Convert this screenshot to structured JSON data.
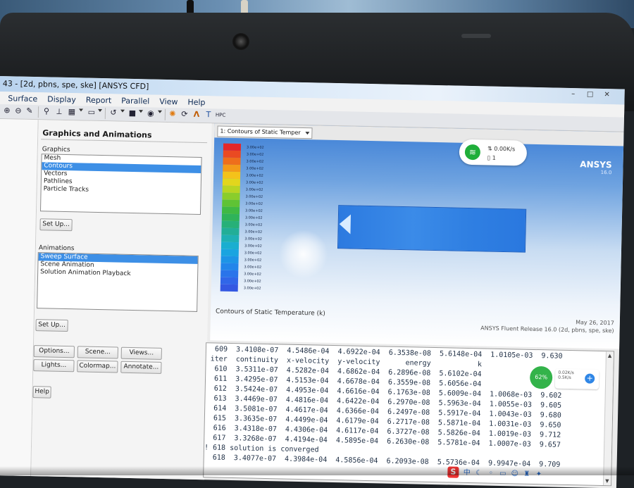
{
  "window": {
    "title": "43 - [2d, pbns, spe, ske] [ANSYS CFD]"
  },
  "menu": [
    "Surface",
    "Display",
    "Report",
    "Parallel",
    "View",
    "Help"
  ],
  "panel": {
    "title": "Graphics and Animations",
    "graphics_label": "Graphics",
    "graphics_items": [
      "Mesh",
      "Contours",
      "Vectors",
      "Pathlines",
      "Particle Tracks"
    ],
    "graphics_selected": "Contours",
    "setup_label": "Set Up...",
    "animations_label": "Animations",
    "animation_items": [
      "Sweep Surface",
      "Scene Animation",
      "Solution Animation Playback"
    ],
    "animation_selected": "Sweep Surface",
    "setup2_label": "Set Up...",
    "buttons": [
      "Options...",
      "Scene...",
      "Views...",
      "Lights...",
      "Colormap...",
      "Annotate..."
    ],
    "help_label": "Help"
  },
  "graphics_window": {
    "tab_label": "1: Contours of Static Temper",
    "colorbar_labels": [
      "3.00e+02",
      "3.00e+02",
      "3.00e+02",
      "3.00e+02",
      "3.00e+02",
      "3.00e+02",
      "3.00e+02",
      "3.00e+02",
      "3.00e+02",
      "3.00e+02",
      "3.00e+02",
      "3.00e+02",
      "3.00e+02",
      "3.00e+02",
      "3.00e+02",
      "3.00e+02",
      "3.00e+02",
      "3.00e+02",
      "3.00e+02",
      "3.00e+02",
      "3.00e+02"
    ],
    "colorbar_colors": [
      "#e3272a",
      "#ea4a22",
      "#ee6e1c",
      "#f39a19",
      "#f4c21a",
      "#e2d61d",
      "#b8d523",
      "#8acd2c",
      "#5fc335",
      "#3fb944",
      "#2fb35a",
      "#27b078",
      "#22ae97",
      "#1fb0b4",
      "#1aaed0",
      "#1aa4e0",
      "#1d94e6",
      "#2285ea",
      "#2a74ea",
      "#3166e8",
      "#3458e2"
    ],
    "logo": "ANSYS",
    "logo_version": "16.0",
    "caption": "Contours of Static Temperature (k)",
    "date": "May 26, 2017",
    "release": "ANSYS Fluent Release 16.0 (2d, pbns, spe, ske)"
  },
  "network_widget": {
    "speed": "0.00K/s",
    "count": "1"
  },
  "console": {
    "lines": [
      "  609  3.4108e-07  4.5486e-04  4.6922e-04  6.3538e-08  5.6148e-04  1.0105e-03  9.630",
      " iter  continuity  x-velocity  y-velocity      energy           k",
      "  610  3.5311e-07  4.5282e-04  4.6862e-04  6.2896e-08  5.6102e-04",
      "  611  3.4295e-07  4.5153e-04  4.6678e-04  6.3559e-08  5.6056e-04",
      "  612  3.5424e-07  4.4953e-04  4.6616e-04  6.1763e-08  5.6009e-04  1.0068e-03  9.602",
      "  613  3.4469e-07  4.4816e-04  4.6422e-04  6.2970e-08  5.5963e-04  1.0055e-03  9.605",
      "  614  3.5081e-07  4.4617e-04  4.6366e-04  6.2497e-08  5.5917e-04  1.0043e-03  9.680",
      "  615  3.3635e-07  4.4499e-04  4.6179e-04  6.2717e-08  5.5871e-04  1.0031e-03  9.650",
      "  616  3.4318e-07  4.4306e-04  4.6117e-04  6.3727e-08  5.5826e-04  1.0019e-03  9.712",
      "  617  3.3268e-07  4.4194e-04  4.5895e-04  6.2630e-08  5.5781e-04  1.0007e-03  9.657",
      "! 618 solution is converged",
      "  618  3.4077e-07  4.3984e-04  4.5856e-04  6.2093e-08  5.5736e-04  9.9947e-04  9.709"
    ],
    "overlay_percent": "62%",
    "overlay_up": "0.02K/s",
    "overlay_down": "0.5K/s"
  },
  "ime": {
    "logo": "S",
    "mode": "中"
  }
}
